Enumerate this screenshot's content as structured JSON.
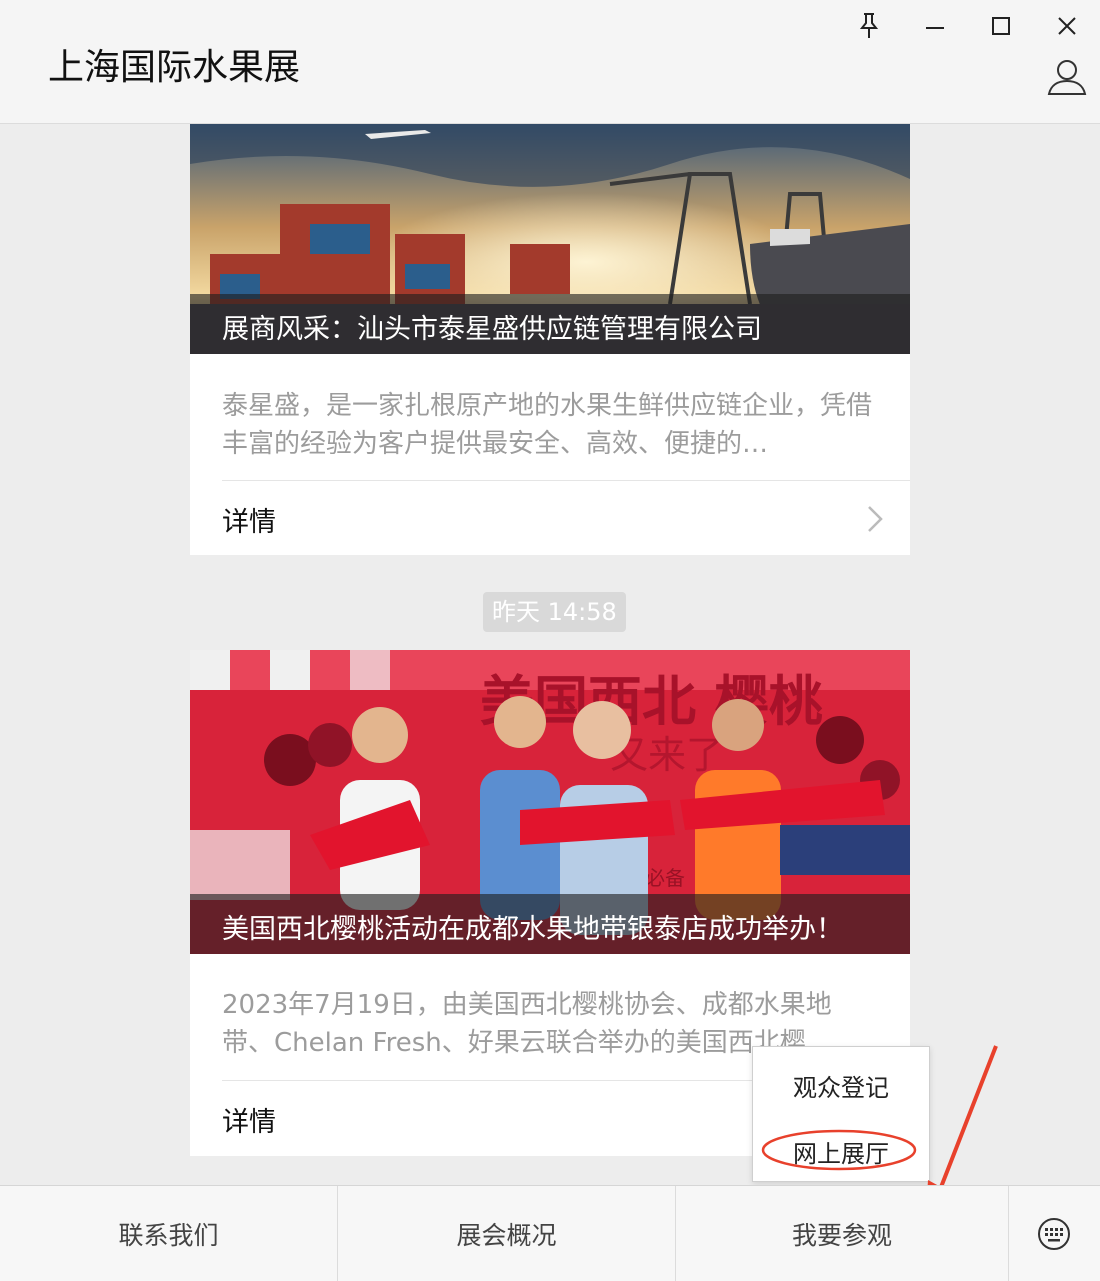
{
  "window": {
    "title": "上海国际水果展",
    "controls": [
      "pin-icon",
      "minimize-icon",
      "maximize-icon",
      "close-icon"
    ],
    "user_icon": "user-icon"
  },
  "articles": [
    {
      "image_caption": "展商风采：汕头市泰星盛供应链管理有限公司",
      "summary": "泰星盛，是一家扎根原产地的水果生鲜供应链企业，凭借丰富的经验为客户提供最安全、高效、便捷的…",
      "detail_label": "详情"
    },
    {
      "timestamp": "昨天 14:58",
      "image_caption": "美国西北樱桃活动在成都水果地带银泰店成功举办！",
      "summary": "2023年7月19日，由美国西北樱桃协会、成都水果地带、Chelan Fresh、好果云联合举办的美国西北樱",
      "detail_label": "详情",
      "image_texts": {
        "banner_main": "美国西北 樱桃",
        "banner_sub": "又来了",
        "banner_small": "必备"
      }
    }
  ],
  "menu": {
    "items": [
      "联系我们",
      "展会概况",
      "我要参观"
    ],
    "keyboard_icon": "keyboard-icon",
    "submenu": [
      "观众登记",
      "网上展厅"
    ]
  },
  "annotation": {
    "color": "#e8412c"
  }
}
